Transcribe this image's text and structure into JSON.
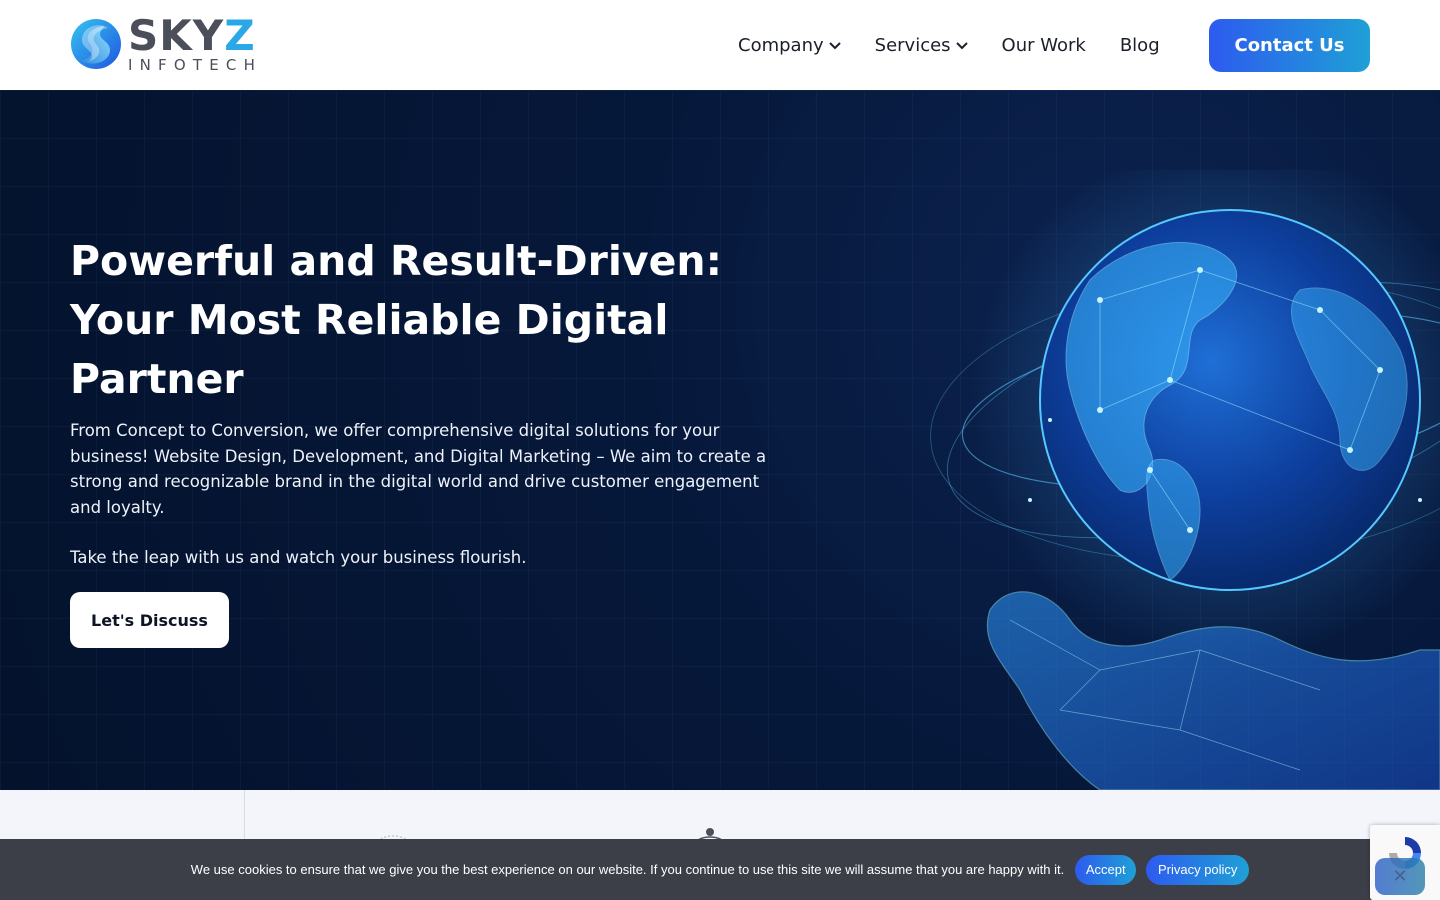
{
  "brand": {
    "name_main": "SKY",
    "name_accent": "Z",
    "subtitle": "INFOTECH",
    "colors": {
      "primary": "#2d5bef",
      "secondary": "#1fa0d6",
      "hero_bg": "#04122c",
      "text_dark": "#1b1f2a"
    }
  },
  "nav": {
    "items": [
      {
        "label": "Company",
        "has_dropdown": true
      },
      {
        "label": "Services",
        "has_dropdown": true
      },
      {
        "label": "Our Work",
        "has_dropdown": false
      },
      {
        "label": "Blog",
        "has_dropdown": false
      }
    ],
    "contact_label": "Contact Us"
  },
  "hero": {
    "title": "Powerful and Result-Driven: Your Most Reliable Digital Partner",
    "description": "From Concept to Conversion, we offer comprehensive digital solutions for your business! Website Design, Development, and Digital Marketing – We aim to create a strong and recognizable brand in the digital world and drive customer engagement and loyalty.",
    "cta_text": "Take the leap with us and watch your business flourish.",
    "cta_button": "Let's Discuss",
    "image_icon": "globe-hand-network-illustration"
  },
  "cookie": {
    "message": "We use cookies to ensure that we give you the best experience on our website. If you continue to use this site we will assume that you are happy with it.",
    "accept_label": "Accept",
    "policy_label": "Privacy policy"
  },
  "widgets": {
    "recaptcha_icon": "recaptcha-icon",
    "chat_icon": "chat-icon"
  }
}
